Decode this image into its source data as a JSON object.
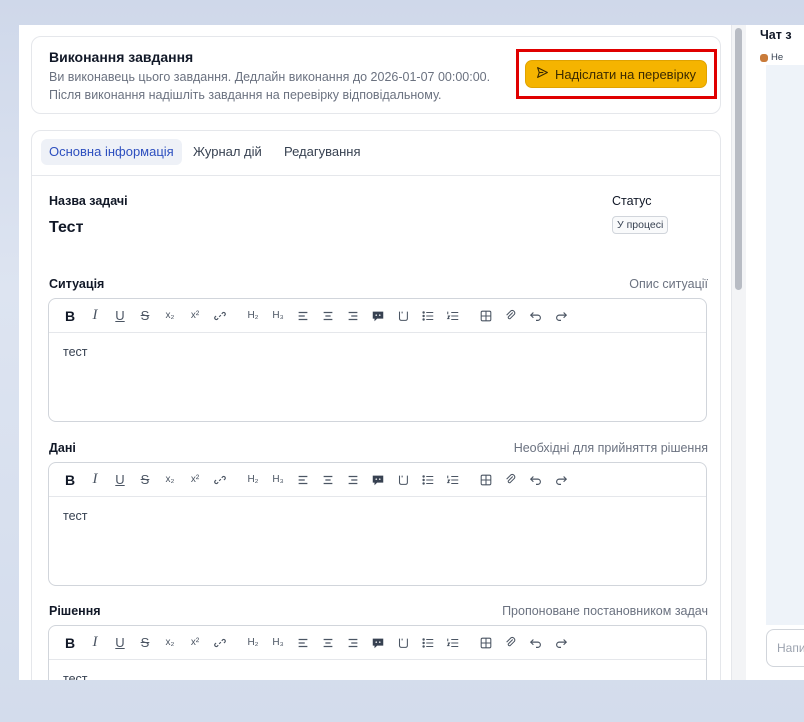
{
  "execution": {
    "title": "Виконання завдання",
    "line1": "Ви виконавець цього завдання. Дедлайн виконання до 2026-01-07 00:00:00.",
    "line2": "Після виконання надішліть завдання на перевірку відповідальному.",
    "send_button": "Надіслати на перевірку"
  },
  "tabs": [
    "Основна інформація",
    "Журнал дій",
    "Редагування"
  ],
  "task": {
    "name_label": "Назва задачі",
    "name_value": "Тест",
    "status_label": "Статус",
    "status_value": "У процесі"
  },
  "sections": {
    "situation": {
      "label": "Ситуація",
      "hint": "Опис ситуації",
      "content": "тест"
    },
    "data": {
      "label": "Дані",
      "hint": "Необхідні для прийняття рішення",
      "content": "тест"
    },
    "solution": {
      "label": "Рішення",
      "hint": "Пропоноване постановником задач",
      "content": "тест"
    }
  },
  "toolbar": {
    "bold": "B",
    "italic": "I",
    "underline": "U",
    "strike": "S",
    "subscript": "x₂",
    "superscript": "x²",
    "h2": "H₂",
    "h3": "H₃"
  },
  "chat": {
    "title": "Чат з",
    "subtitle": "Не",
    "input_placeholder": "Напишіть"
  }
}
